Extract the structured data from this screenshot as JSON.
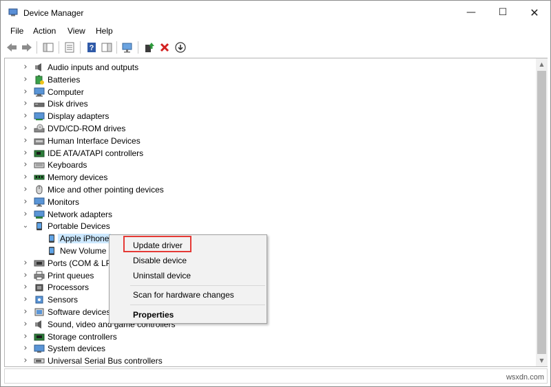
{
  "window": {
    "title": "Device Manager",
    "minimize_glyph": "—",
    "maximize_glyph": "☐",
    "close_glyph": "✕"
  },
  "menu": [
    "File",
    "Action",
    "View",
    "Help"
  ],
  "toolbar": {
    "buttons": [
      "back-arrow",
      "forward-arrow",
      "show-hide-console-tree",
      "properties",
      "help",
      "action-pane",
      "monitor",
      "update-driver",
      "uninstall-device",
      "download"
    ]
  },
  "tree": {
    "items": [
      {
        "label": "Audio inputs and outputs",
        "icon": "speaker-icon",
        "expanded": false
      },
      {
        "label": "Batteries",
        "icon": "battery-icon",
        "expanded": false
      },
      {
        "label": "Computer",
        "icon": "computer-icon",
        "expanded": false
      },
      {
        "label": "Disk drives",
        "icon": "disk-drive-icon",
        "expanded": false
      },
      {
        "label": "Display adapters",
        "icon": "display-adapter-icon",
        "expanded": false
      },
      {
        "label": "DVD/CD-ROM drives",
        "icon": "dvd-drive-icon",
        "expanded": false
      },
      {
        "label": "Human Interface Devices",
        "icon": "hid-icon",
        "expanded": false
      },
      {
        "label": "IDE ATA/ATAPI controllers",
        "icon": "ide-controller-icon",
        "expanded": false
      },
      {
        "label": "Keyboards",
        "icon": "keyboard-icon",
        "expanded": false
      },
      {
        "label": "Memory devices",
        "icon": "memory-icon",
        "expanded": false
      },
      {
        "label": "Mice and other pointing devices",
        "icon": "mouse-icon",
        "expanded": false
      },
      {
        "label": "Monitors",
        "icon": "monitor-icon",
        "expanded": false
      },
      {
        "label": "Network adapters",
        "icon": "network-adapter-icon",
        "expanded": false
      },
      {
        "label": "Portable Devices",
        "icon": "portable-device-icon",
        "expanded": true
      },
      {
        "label": "Apple iPhone",
        "icon": "phone-icon",
        "child": true,
        "selected": true
      },
      {
        "label": "New Volume",
        "icon": "phone-icon",
        "child": true
      },
      {
        "label": "Ports (COM & LP",
        "icon": "port-icon",
        "expanded": false
      },
      {
        "label": "Print queues",
        "icon": "printer-icon",
        "expanded": false
      },
      {
        "label": "Processors",
        "icon": "processor-icon",
        "expanded": false
      },
      {
        "label": "Sensors",
        "icon": "sensor-icon",
        "expanded": false
      },
      {
        "label": "Software devices",
        "icon": "software-device-icon",
        "expanded": false
      },
      {
        "label": "Sound, video and game controllers",
        "icon": "sound-icon",
        "expanded": false
      },
      {
        "label": "Storage controllers",
        "icon": "storage-controller-icon",
        "expanded": false
      },
      {
        "label": "System devices",
        "icon": "system-device-icon",
        "expanded": false
      },
      {
        "label": "Universal Serial Bus controllers",
        "icon": "usb-icon",
        "expanded": false
      }
    ]
  },
  "context_menu": {
    "update_driver": "Update driver",
    "disable_device": "Disable device",
    "uninstall_device": "Uninstall device",
    "scan": "Scan for hardware changes",
    "properties": "Properties"
  },
  "watermark": "wsxdn.com",
  "colors": {
    "highlight_border": "#e53935",
    "selection": "#cce8ff"
  }
}
